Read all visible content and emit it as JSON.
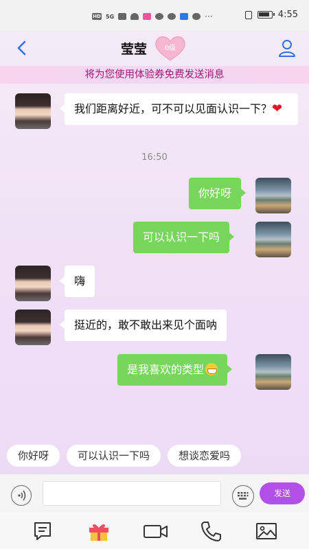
{
  "status_bar": {
    "time": "4:55",
    "network_badge": "HD",
    "signal_label": "5G"
  },
  "header": {
    "title": "莹莹",
    "level": "0级"
  },
  "notice": "将为您使用体验券免费发送消息",
  "messages": [
    {
      "side": "left",
      "text": "我们距离好近，可不可以见面认识一下？",
      "emoji": "❤"
    },
    {
      "side": "right",
      "text": "你好呀"
    },
    {
      "side": "right",
      "text": "可以认识一下吗"
    },
    {
      "side": "left",
      "text": "嗨"
    },
    {
      "side": "left",
      "text": "挺近的，敢不敢出来见个面呐"
    },
    {
      "side": "right",
      "text": "是我喜欢的类型",
      "emoji": "grin"
    }
  ],
  "timestamp": "16:50",
  "quick_replies": [
    "你好呀",
    "可以认识一下吗",
    "想谈恋爱吗"
  ],
  "input": {
    "value": "",
    "placeholder": "",
    "send_label": "发送"
  },
  "toolbar_icons": [
    "message-icon",
    "gift-icon",
    "video-icon",
    "phone-icon",
    "image-icon"
  ],
  "colors": {
    "accent_purple": "#b34fe8",
    "sent_bubble": "#79d65c",
    "notice_text": "#a01875",
    "back_blue": "#2f6fe6"
  }
}
